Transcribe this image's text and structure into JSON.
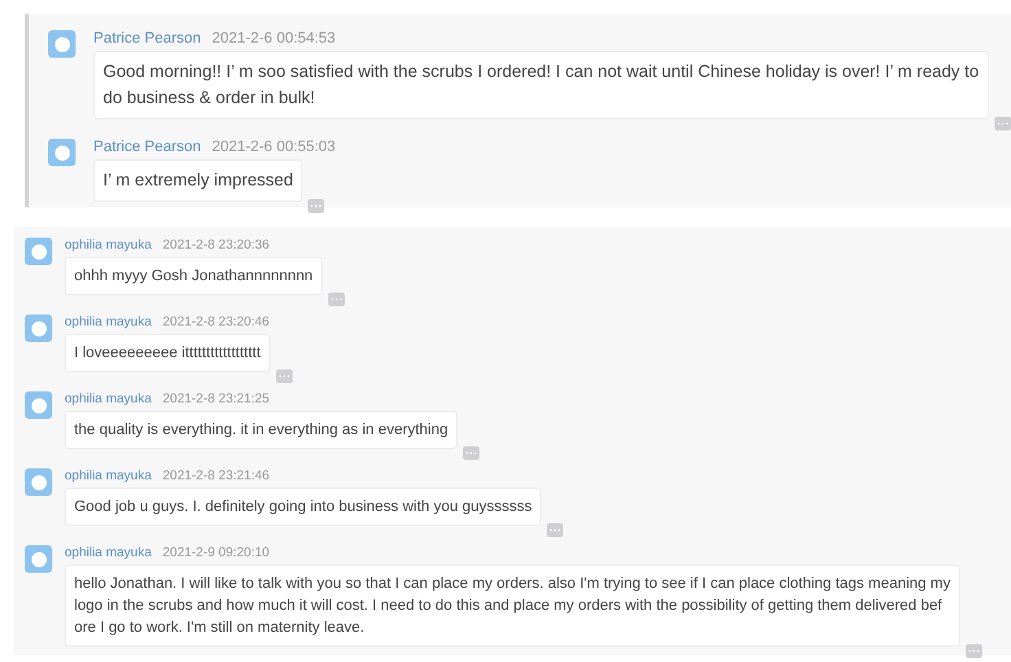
{
  "groups": [
    {
      "kind": "quoted",
      "messages": [
        {
          "sender": "Patrice Pearson",
          "time": "2021-2-6 00:54:53",
          "lines": [
            "Good morning!! I’  m soo satisfied with the scrubs I ordered! I can not wait until Chinese holiday is over! I’  m ready to",
            "do business & order in bulk!"
          ]
        },
        {
          "sender": "Patrice Pearson",
          "time": "2021-2-6 00:55:03",
          "lines": [
            "I’  m extremely impressed"
          ]
        }
      ]
    },
    {
      "kind": "plain",
      "messages": [
        {
          "sender": "ophilia mayuka",
          "time": "2021-2-8 23:20:36",
          "lines": [
            "ohhh myyy Gosh Jonathannnnnnnn"
          ]
        },
        {
          "sender": "ophilia mayuka",
          "time": "2021-2-8 23:20:46",
          "lines": [
            "I loveeeeeeeee itttttttttttttttttt"
          ]
        },
        {
          "sender": "ophilia mayuka",
          "time": "2021-2-8 23:21:25",
          "lines": [
            "the quality is everything.  it in everything  as in everything"
          ]
        },
        {
          "sender": "ophilia mayuka",
          "time": "2021-2-8 23:21:46",
          "lines": [
            "Good job u guys. I. definitely going into business with you guyssssss"
          ]
        },
        {
          "sender": "ophilia mayuka",
          "time": "2021-2-9 09:20:10",
          "lines": [
            "hello Jonathan. I will like to talk with you so that I can place my orders. also I'm trying to see if I can place clothing tags meaning my",
            "logo in the scrubs and how much it will cost. I need to do this and place my orders with the possibility of getting them delivered bef",
            "ore I go to work. I'm still on maternity leave."
          ]
        }
      ]
    }
  ]
}
